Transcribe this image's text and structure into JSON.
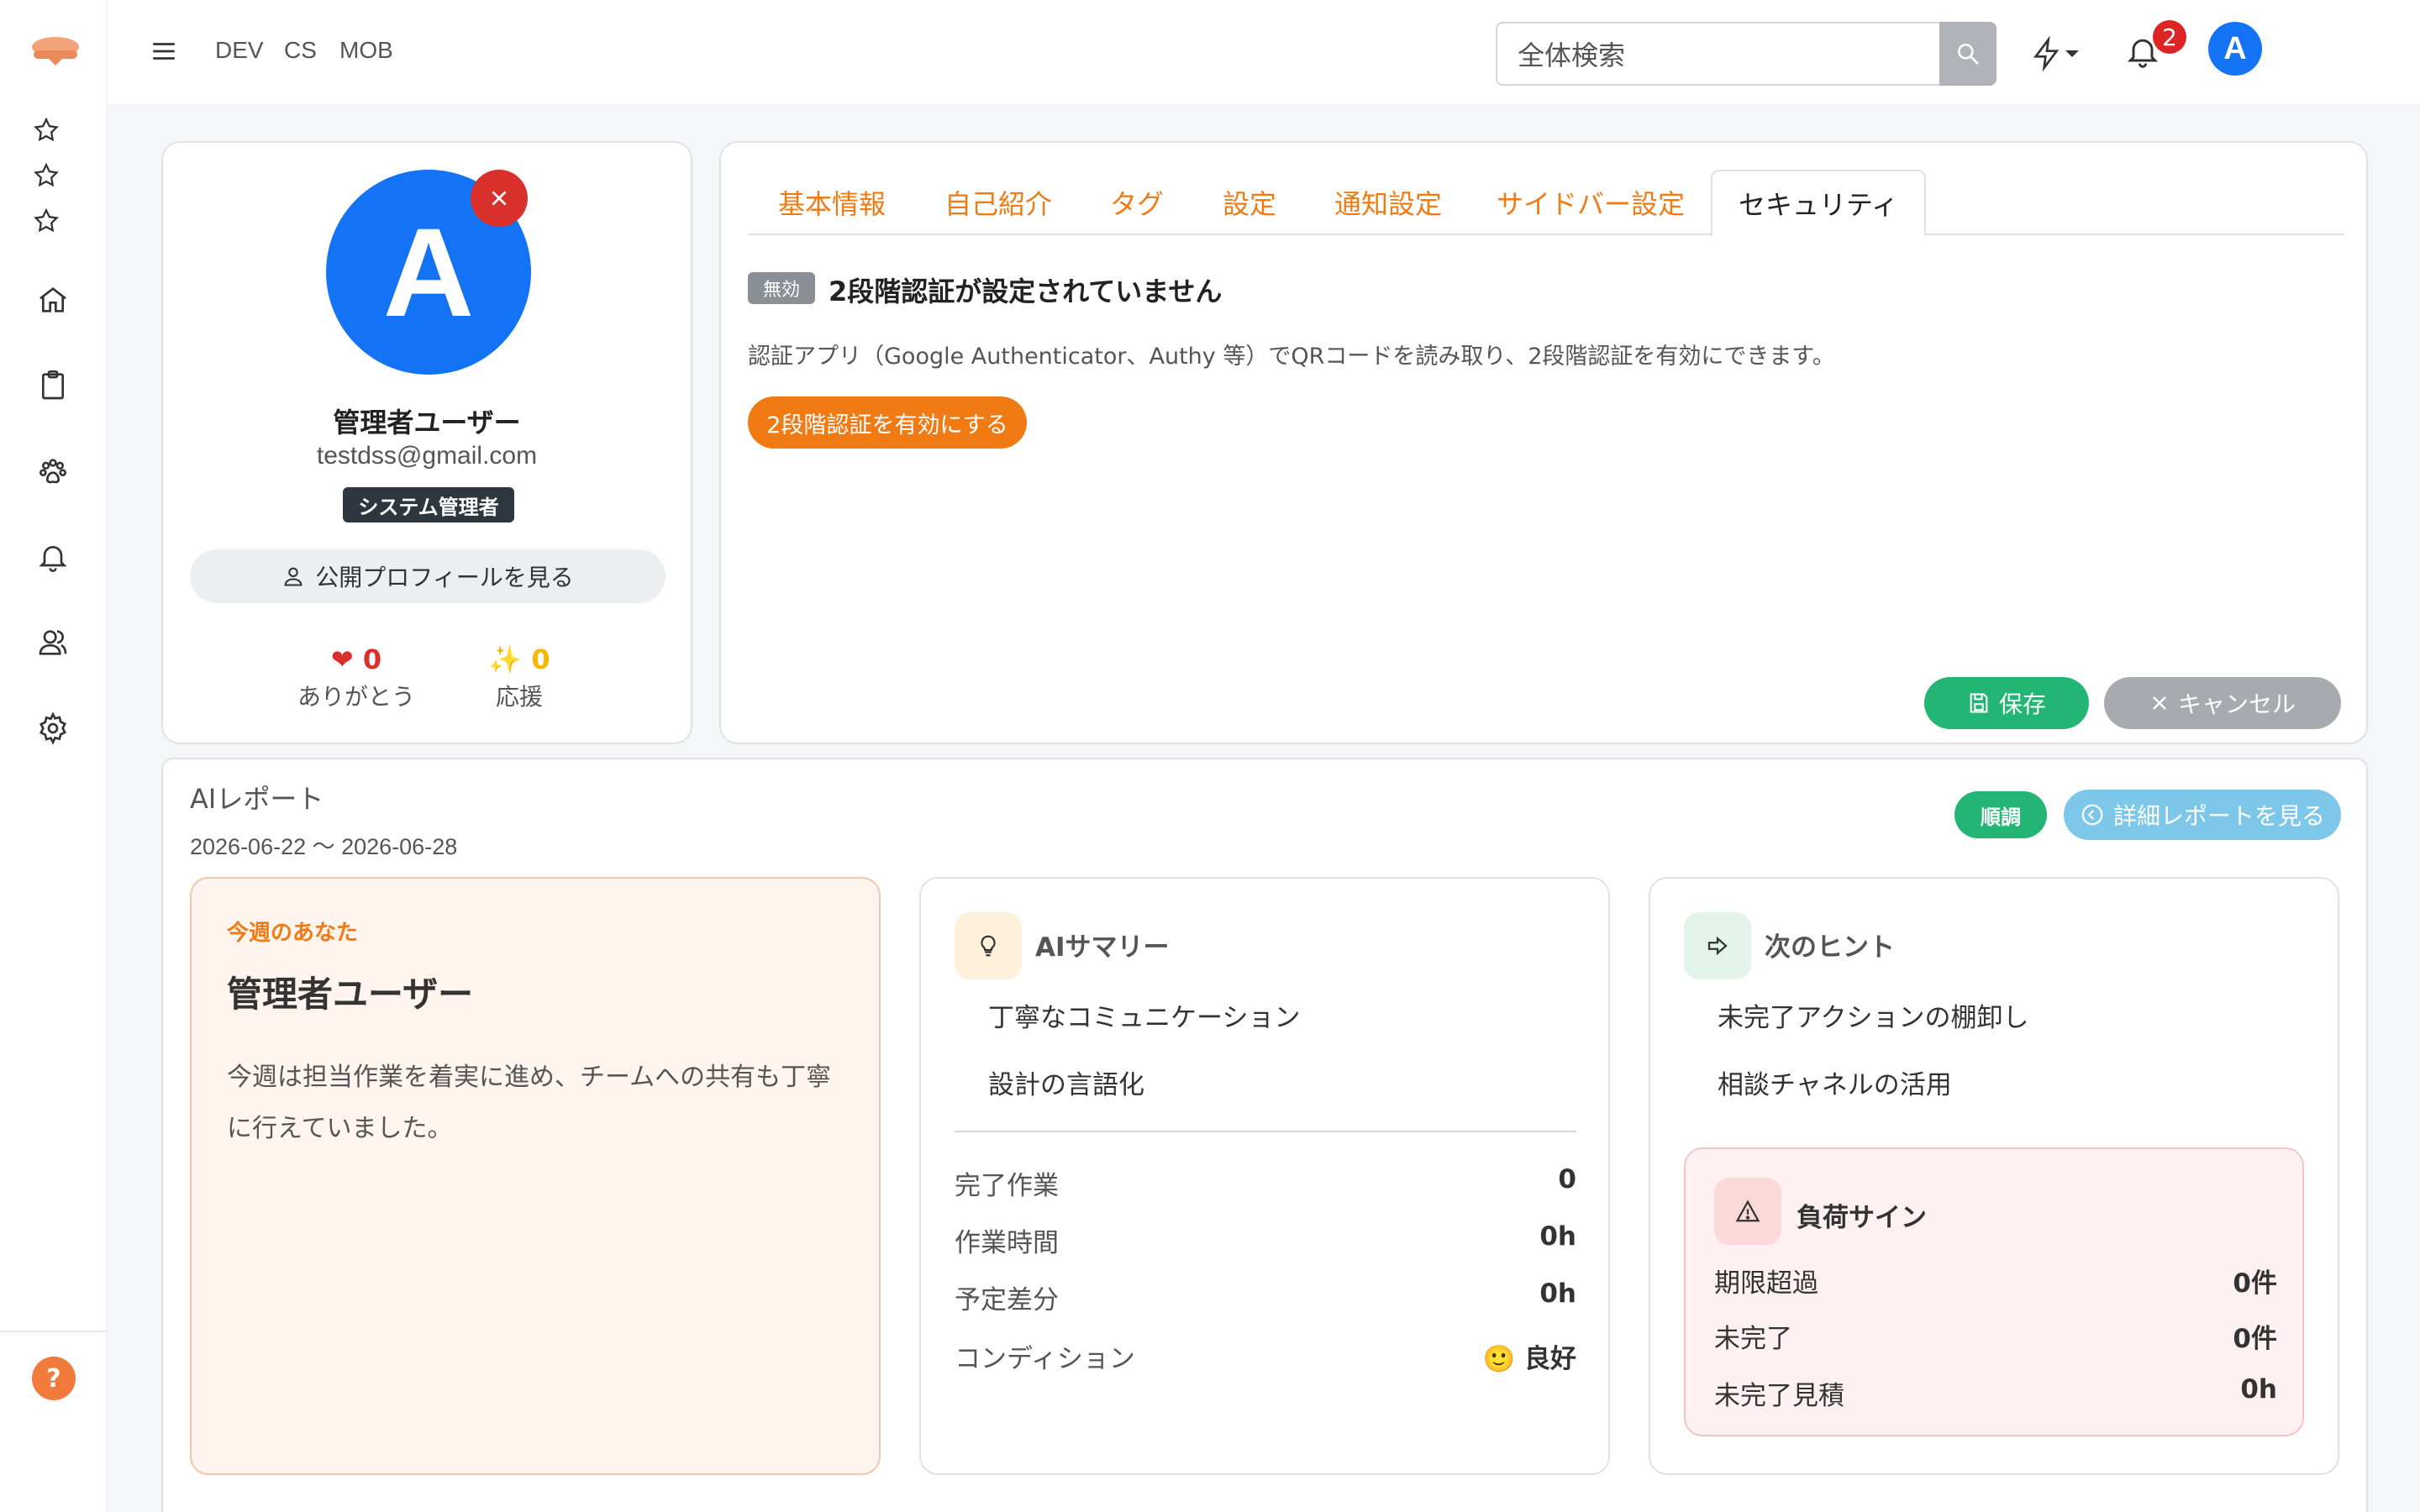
{
  "topnav": {
    "links": [
      "DEV",
      "CS",
      "MOB"
    ]
  },
  "search": {
    "placeholder": "全体検索"
  },
  "notifications": {
    "count": "2"
  },
  "user_initial": "A",
  "profile": {
    "avatar_letter": "A",
    "name": "管理者ユーザー",
    "email": "testdss@gmail.com",
    "role": "システム管理者",
    "public_profile_label": "公開プロフィールを見る",
    "thanks": {
      "value": "0",
      "label": "ありがとう",
      "icon": "heart-icon",
      "color": "#d9302c"
    },
    "cheer": {
      "value": "0",
      "label": "応援",
      "icon": "sparkles-icon",
      "color": "#f5b800"
    }
  },
  "tabs": [
    "基本情報",
    "自己紹介",
    "タグ",
    "設定",
    "通知設定",
    "サイドバー設定",
    "セキュリティ"
  ],
  "active_tab": "セキュリティ",
  "security": {
    "status_tag": "無効",
    "title": "2段階認証が設定されていません",
    "description": "認証アプリ（Google Authenticator、Authy 等）でQRコードを読み取り、2段階認証を有効にできます。",
    "enable_button": "2段階認証を有効にする"
  },
  "actions": {
    "save": "保存",
    "cancel": "キャンセル"
  },
  "report": {
    "title": "AIレポート",
    "range": "2026-06-22 〜 2026-06-28",
    "status": "順調",
    "detail_button": "詳細レポートを見る",
    "you": {
      "kicker": "今週のあなた",
      "name": "管理者ユーザー",
      "text": "今週は担当作業を着実に進め、チームへの共有も丁寧に行えていました。"
    },
    "summary": {
      "title": "AIサマリー",
      "points": [
        "丁寧なコミュニケーション",
        "設計の言語化"
      ],
      "stats": [
        {
          "label": "完了作業",
          "value": "0"
        },
        {
          "label": "作業時間",
          "value": "0h"
        },
        {
          "label": "予定差分",
          "value": "0h"
        },
        {
          "label": "コンディション",
          "value": "🙂 良好"
        }
      ]
    },
    "hints": {
      "title": "次のヒント",
      "points": [
        "未完了アクションの棚卸し",
        "相談チャネルの活用"
      ],
      "load": {
        "title": "負荷サイン",
        "items": [
          {
            "label": "期限超過",
            "value": "0件"
          },
          {
            "label": "未完了",
            "value": "0件"
          },
          {
            "label": "未完了見積",
            "value": "0h"
          }
        ]
      }
    }
  },
  "colors": {
    "accent": "#f07b14",
    "brand_blue": "#1472f4",
    "success": "#22b573",
    "danger": "#d9302c"
  }
}
